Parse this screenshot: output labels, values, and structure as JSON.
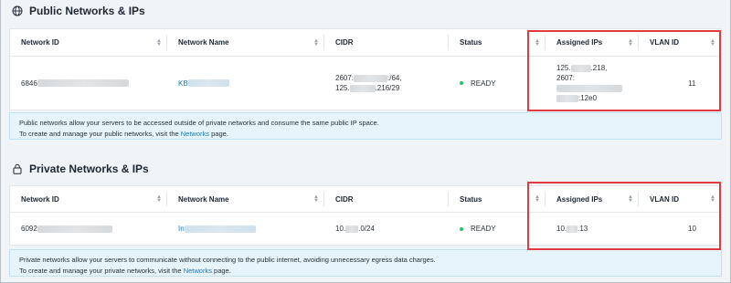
{
  "public": {
    "title": "Public Networks & IPs",
    "headers": [
      "Network ID",
      "Network Name",
      "CIDR",
      "Status",
      "Assigned IPs",
      "VLAN ID"
    ],
    "row": {
      "network_id": "6846",
      "network_name": "KB",
      "cidr_line1_a": "2607:",
      "cidr_line1_b": ":/64,",
      "cidr_line2_a": "125.",
      "cidr_line2_b": ".216/29",
      "status": "READY",
      "ip_line1_a": "125.",
      "ip_line1_b": ".218,",
      "ip_line2": "2607:",
      "ip_line3": ":12e0",
      "vlan": "11"
    },
    "info_line1": "Public networks allow your servers to be accessed outside of private networks and consume the same public IP space.",
    "info_line2_pre": "To create and manage your public networks, visit the ",
    "info_link": "Networks",
    "info_line2_post": " page."
  },
  "private": {
    "title": "Private Networks & IPs",
    "headers": [
      "Network ID",
      "Network Name",
      "CIDR",
      "Status",
      "Assigned IPs",
      "VLAN ID"
    ],
    "row": {
      "network_id": "6092",
      "network_name": "In",
      "cidr_a": "10.",
      "cidr_b": ".0/24",
      "status": "READY",
      "ip_a": "10.",
      "ip_b": ".13",
      "vlan": "10"
    },
    "info_line1": "Private networks allow your servers to communicate without connecting to the public internet, avoiding unnecessary egress data charges.",
    "info_line2_pre": "To create and manage your private networks, visit the ",
    "info_link": "Networks",
    "info_line2_post": " page."
  },
  "colors": {
    "highlight": "#e23b3f",
    "link": "#1a78c2",
    "status_ready": "#22c55e",
    "info_bg": "#e6f4fb"
  },
  "icons": {
    "public": "globe-icon",
    "private": "lock-icon",
    "sort": "sort-icon"
  }
}
